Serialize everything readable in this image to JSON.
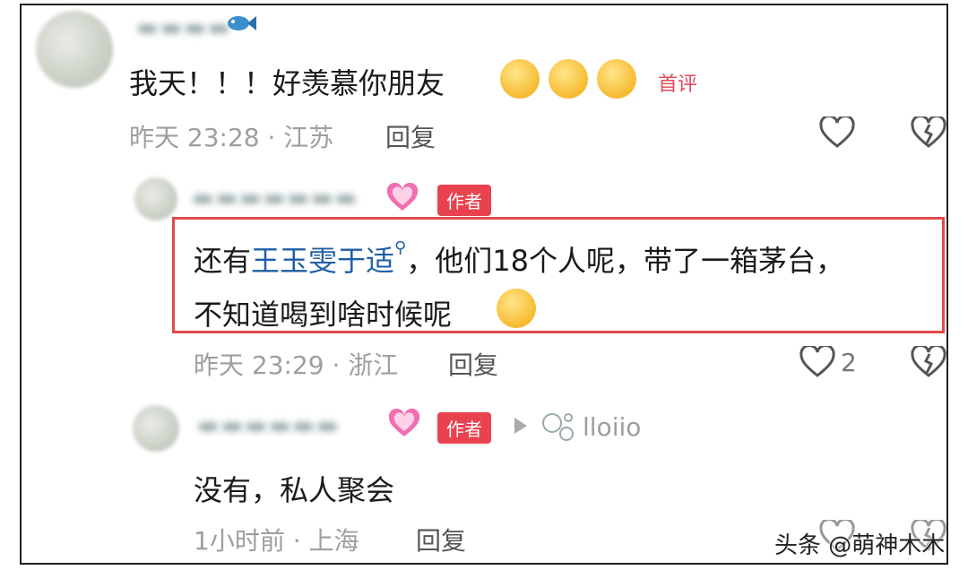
{
  "comments": [
    {
      "text": "我天！！！好羡慕你朋友",
      "badge": "首评",
      "time": "昨天 23:28 · 江苏",
      "reply": "回复",
      "emoji": "pleading-face-icon"
    },
    {
      "author_badge": "作者",
      "text_before": "还有",
      "link_text": "王玉雯于适",
      "text_after": "，他们18个人呢，带了一箱茅台，",
      "text_line2": "不知道喝到啥时候呢",
      "time": "昨天 23:29 · 浙江",
      "reply": "回复",
      "likes": "2",
      "emoji": "laughing-crying-face-icon"
    },
    {
      "author_badge": "作者",
      "reply_to": "lloiio",
      "text": "没有，私人聚会",
      "time": "1小时前 · 上海",
      "reply": "回复"
    }
  ],
  "watermark": "头条 @萌神木木",
  "colors": {
    "badge": "#e9424f",
    "highlight": "#e24b4b",
    "link": "#1f5fa6"
  }
}
